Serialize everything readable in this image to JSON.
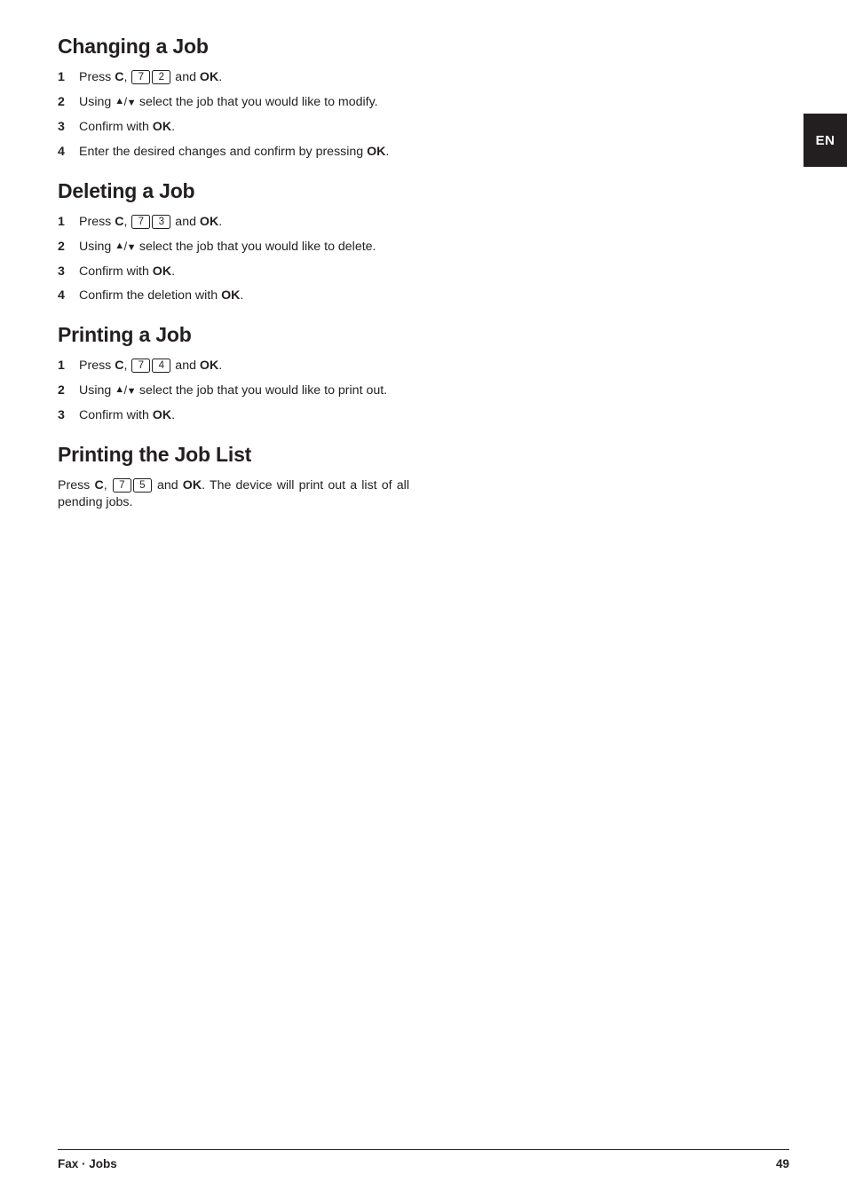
{
  "language_tab": {
    "label": "EN"
  },
  "sections": [
    {
      "id": "changing-a-job",
      "title": "Changing a Job",
      "steps": [
        {
          "num": "1",
          "parts": [
            {
              "t": "text",
              "v": "Press "
            },
            {
              "t": "bold",
              "v": "C"
            },
            {
              "t": "text",
              "v": ", "
            },
            {
              "t": "key",
              "v": "7"
            },
            {
              "t": "key",
              "v": "2"
            },
            {
              "t": "text",
              "v": " and "
            },
            {
              "t": "bold",
              "v": "OK"
            },
            {
              "t": "text",
              "v": "."
            }
          ]
        },
        {
          "num": "2",
          "parts": [
            {
              "t": "text",
              "v": "Using "
            },
            {
              "t": "arrows",
              "v": "up/down"
            },
            {
              "t": "text",
              "v": " select the job that you would like to modify."
            }
          ]
        },
        {
          "num": "3",
          "parts": [
            {
              "t": "text",
              "v": "Confirm with "
            },
            {
              "t": "bold",
              "v": "OK"
            },
            {
              "t": "text",
              "v": "."
            }
          ]
        },
        {
          "num": "4",
          "parts": [
            {
              "t": "text",
              "v": "Enter the desired changes and confirm by pressing "
            },
            {
              "t": "bold",
              "v": "OK"
            },
            {
              "t": "text",
              "v": "."
            }
          ]
        }
      ]
    },
    {
      "id": "deleting-a-job",
      "title": "Deleting a Job",
      "steps": [
        {
          "num": "1",
          "parts": [
            {
              "t": "text",
              "v": "Press "
            },
            {
              "t": "bold",
              "v": "C"
            },
            {
              "t": "text",
              "v": ", "
            },
            {
              "t": "key",
              "v": "7"
            },
            {
              "t": "key",
              "v": "3"
            },
            {
              "t": "text",
              "v": " and "
            },
            {
              "t": "bold",
              "v": "OK"
            },
            {
              "t": "text",
              "v": "."
            }
          ]
        },
        {
          "num": "2",
          "parts": [
            {
              "t": "text",
              "v": "Using "
            },
            {
              "t": "arrows",
              "v": "up/down"
            },
            {
              "t": "text",
              "v": " select the job that you would like to delete."
            }
          ]
        },
        {
          "num": "3",
          "parts": [
            {
              "t": "text",
              "v": "Confirm with "
            },
            {
              "t": "bold",
              "v": "OK"
            },
            {
              "t": "text",
              "v": "."
            }
          ]
        },
        {
          "num": "4",
          "parts": [
            {
              "t": "text",
              "v": "Confirm the deletion with "
            },
            {
              "t": "bold",
              "v": "OK"
            },
            {
              "t": "text",
              "v": "."
            }
          ]
        }
      ]
    },
    {
      "id": "printing-a-job",
      "title": "Printing a Job",
      "steps": [
        {
          "num": "1",
          "parts": [
            {
              "t": "text",
              "v": "Press "
            },
            {
              "t": "bold",
              "v": "C"
            },
            {
              "t": "text",
              "v": ", "
            },
            {
              "t": "key",
              "v": "7"
            },
            {
              "t": "key",
              "v": "4"
            },
            {
              "t": "text",
              "v": " and "
            },
            {
              "t": "bold",
              "v": "OK"
            },
            {
              "t": "text",
              "v": "."
            }
          ]
        },
        {
          "num": "2",
          "parts": [
            {
              "t": "text",
              "v": "Using "
            },
            {
              "t": "arrows",
              "v": "up/down"
            },
            {
              "t": "text",
              "v": " select the job that you would like to print out."
            }
          ]
        },
        {
          "num": "3",
          "parts": [
            {
              "t": "text",
              "v": "Confirm with "
            },
            {
              "t": "bold",
              "v": "OK"
            },
            {
              "t": "text",
              "v": "."
            }
          ]
        }
      ]
    },
    {
      "id": "printing-the-job-list",
      "title": "Printing the Job List",
      "paragraph": [
        {
          "t": "text",
          "v": "Press "
        },
        {
          "t": "bold",
          "v": "C"
        },
        {
          "t": "text",
          "v": ", "
        },
        {
          "t": "key",
          "v": "7"
        },
        {
          "t": "key",
          "v": "5"
        },
        {
          "t": "text",
          "v": " and "
        },
        {
          "t": "bold",
          "v": "OK"
        },
        {
          "t": "text",
          "v": ". The device will print out a list of all pending jobs."
        }
      ]
    }
  ],
  "footer": {
    "left": "Fax · Jobs",
    "page_number": "49"
  },
  "colors": {
    "ink": "#231f20",
    "paper": "#ffffff",
    "tab_background": "#231f20",
    "tab_text": "#ffffff"
  }
}
